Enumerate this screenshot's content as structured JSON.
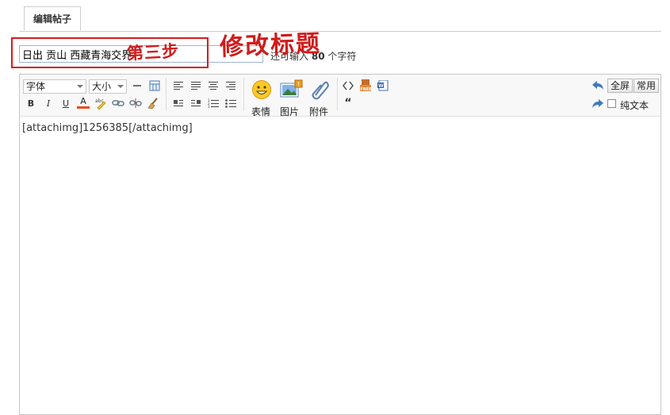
{
  "tab": {
    "label": "编辑帖子"
  },
  "subject": {
    "value": "日出 贡山 西藏青海交界",
    "hint_prefix": "还可输入",
    "hint_count": "80",
    "hint_suffix": "个字符"
  },
  "annotations": {
    "step": "第三步",
    "title": "修改标题"
  },
  "toolbar": {
    "font_label": "字体",
    "size_label": "大小",
    "emoji_label": "表情",
    "image_label": "图片",
    "attach_label": "附件",
    "fullscreen_label": "全屏",
    "common_label": "常用",
    "plaintext_label": "纯文本",
    "bold": "B",
    "italic": "I",
    "underline": "U",
    "color": "A",
    "quote": "“"
  },
  "editor": {
    "content": "[attachimg]1256385[/attachimg]"
  },
  "colors": {
    "annotation": "#d11b1b",
    "input_border": "#9eb5d4",
    "toolbar_bg": "#f8f8f8"
  }
}
